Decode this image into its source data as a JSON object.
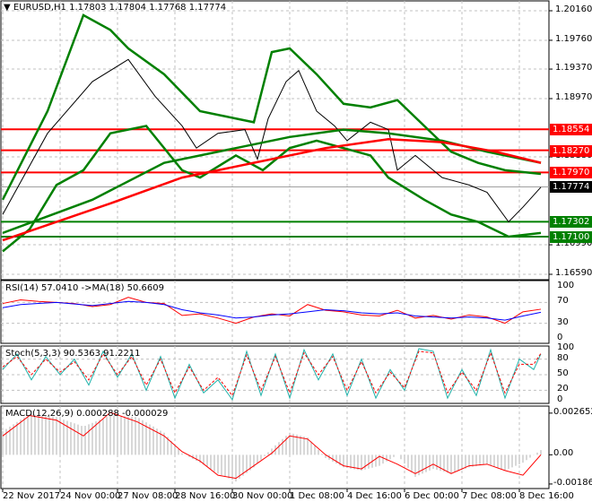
{
  "chart_data": {
    "type": "line",
    "title": "EURUSD,H1",
    "ohlc_header": [
      "1.17803",
      "1.17804",
      "1.17768",
      "1.17774"
    ],
    "price_axis": {
      "ylim": [
        1.1659,
        1.2016
      ],
      "ticks": [
        "1.20160",
        "1.19760",
        "1.19370",
        "1.18970",
        "1.18180",
        "1.16990",
        "1.16590"
      ]
    },
    "time_labels": [
      "22 Nov 2017",
      "24 Nov 00:00",
      "27 Nov 08:00",
      "28 Nov 16:00",
      "30 Nov 00:00",
      "1 Dec 08:00",
      "4 Dec 16:00",
      "6 Dec 00:00",
      "7 Dec 08:00",
      "8 Dec 16:00"
    ],
    "levels": [
      {
        "label": "1.18554",
        "value": 1.18554,
        "color": "#ff0000"
      },
      {
        "label": "1.18270",
        "value": 1.1827,
        "color": "#ff0000"
      },
      {
        "label": "1.17970",
        "value": 1.1797,
        "color": "#ff0000"
      },
      {
        "label": "1.17774",
        "value": 1.17774,
        "color": "#000000",
        "current": true
      },
      {
        "label": "1.17302",
        "value": 1.17302,
        "color": "#008000"
      },
      {
        "label": "1.17100",
        "value": 1.171,
        "color": "#008000"
      }
    ],
    "series": [
      {
        "name": "close",
        "color": "#000000",
        "x": [
          0,
          25,
          50,
          70,
          85,
          100,
          108,
          120,
          135,
          142,
          148,
          158,
          165,
          175,
          185,
          192,
          205,
          215,
          220,
          230,
          245,
          260,
          270,
          282,
          290,
          300
        ],
        "values": [
          1.174,
          1.185,
          1.192,
          1.195,
          1.19,
          1.186,
          1.183,
          1.185,
          1.1855,
          1.1815,
          1.187,
          1.192,
          1.1935,
          1.188,
          1.186,
          1.184,
          1.1865,
          1.1855,
          1.18,
          1.182,
          1.179,
          1.178,
          1.177,
          1.173,
          1.175,
          1.1777
        ]
      },
      {
        "name": "bb_upper",
        "color": "#008000",
        "x": [
          0,
          25,
          45,
          60,
          70,
          90,
          110,
          130,
          140,
          150,
          160,
          175,
          190,
          205,
          220,
          235,
          250,
          265,
          280,
          300
        ],
        "values": [
          1.176,
          1.188,
          1.201,
          1.199,
          1.1965,
          1.193,
          1.188,
          1.187,
          1.1865,
          1.196,
          1.1965,
          1.193,
          1.189,
          1.1885,
          1.1895,
          1.186,
          1.1825,
          1.181,
          1.18,
          1.1795
        ]
      },
      {
        "name": "bb_lower",
        "color": "#008000",
        "x": [
          0,
          15,
          30,
          45,
          60,
          80,
          100,
          110,
          130,
          145,
          160,
          175,
          190,
          205,
          215,
          235,
          250,
          265,
          282,
          300
        ],
        "values": [
          1.169,
          1.172,
          1.178,
          1.18,
          1.185,
          1.186,
          1.18,
          1.179,
          1.182,
          1.18,
          1.183,
          1.184,
          1.183,
          1.182,
          1.179,
          1.176,
          1.174,
          1.173,
          1.171,
          1.1715
        ]
      },
      {
        "name": "ma_green",
        "color": "#008000",
        "x": [
          0,
          50,
          90,
          130,
          160,
          190,
          215,
          245,
          270,
          300
        ],
        "values": [
          1.1715,
          1.176,
          1.181,
          1.183,
          1.1845,
          1.1855,
          1.185,
          1.184,
          1.1825,
          1.181
        ]
      },
      {
        "name": "ma_red",
        "color": "#ff0000",
        "x": [
          0,
          60,
          100,
          140,
          180,
          215,
          245,
          275,
          300
        ],
        "values": [
          1.1705,
          1.1755,
          1.179,
          1.181,
          1.183,
          1.1842,
          1.1838,
          1.1825,
          1.181
        ]
      }
    ],
    "rsi": {
      "label": "RSI(14) 57.0410  ->MA(18) 50.6609",
      "ticks": [
        "100",
        "70",
        "30",
        "0"
      ],
      "ylim": [
        0,
        100
      ],
      "x": [
        0,
        10,
        20,
        30,
        40,
        50,
        60,
        70,
        80,
        90,
        100,
        110,
        120,
        130,
        140,
        150,
        160,
        170,
        180,
        190,
        200,
        210,
        220,
        230,
        240,
        250,
        260,
        270,
        280,
        290,
        300
      ],
      "rsi": [
        68,
        75,
        72,
        70,
        68,
        62,
        66,
        80,
        70,
        68,
        45,
        48,
        40,
        30,
        42,
        48,
        44,
        66,
        55,
        52,
        46,
        44,
        55,
        40,
        45,
        38,
        46,
        42,
        30,
        52,
        57
      ],
      "ma": [
        60,
        66,
        68,
        70,
        67,
        64,
        68,
        72,
        70,
        66,
        56,
        50,
        46,
        40,
        42,
        46,
        48,
        52,
        56,
        54,
        50,
        48,
        50,
        44,
        42,
        40,
        42,
        40,
        36,
        44,
        51
      ]
    },
    "stoch": {
      "label": "Stoch(5,3,3) 90.5363 91.2211",
      "ticks": [
        "100",
        "80",
        "50",
        "20",
        "0"
      ],
      "ylim": [
        0,
        100
      ],
      "x": [
        0,
        8,
        16,
        24,
        32,
        40,
        48,
        56,
        64,
        72,
        80,
        88,
        96,
        104,
        112,
        120,
        128,
        136,
        144,
        152,
        160,
        168,
        176,
        184,
        192,
        200,
        208,
        216,
        224,
        232,
        240,
        248,
        256,
        264,
        272,
        280,
        288,
        296,
        300
      ],
      "main": [
        60,
        90,
        40,
        85,
        50,
        80,
        30,
        95,
        45,
        90,
        20,
        85,
        5,
        70,
        15,
        40,
        2,
        95,
        10,
        90,
        5,
        98,
        40,
        90,
        10,
        80,
        5,
        60,
        20,
        100,
        95,
        5,
        60,
        10,
        98,
        5,
        80,
        60,
        90
      ],
      "signal": [
        65,
        85,
        50,
        80,
        55,
        75,
        40,
        90,
        50,
        85,
        30,
        80,
        15,
        65,
        20,
        45,
        10,
        88,
        20,
        85,
        15,
        92,
        50,
        85,
        20,
        75,
        15,
        55,
        25,
        95,
        92,
        15,
        55,
        20,
        92,
        15,
        70,
        70,
        91
      ]
    },
    "macd": {
      "label": "MACD(12,26,9) 0.000288 -0.000029",
      "ticks": [
        "0.002652",
        "0.00",
        "-0.00186"
      ],
      "ylim": [
        -0.00215,
        0.0031
      ],
      "x": [
        0,
        15,
        30,
        45,
        60,
        75,
        90,
        100,
        110,
        120,
        130,
        140,
        150,
        160,
        170,
        180,
        190,
        200,
        210,
        220,
        230,
        240,
        250,
        260,
        270,
        280,
        290,
        300
      ],
      "hist": [
        0.0015,
        0.0026,
        0.0024,
        0.0018,
        0.0025,
        0.0024,
        0.0014,
        0.0001,
        -0.0005,
        -0.0012,
        -0.0017,
        -0.0008,
        0.0004,
        0.0014,
        0.0011,
        -0.0002,
        -0.0008,
        -0.001,
        -0.0007,
        0.0,
        -0.0014,
        -0.0009,
        -0.0012,
        -0.0008,
        -0.0006,
        -0.001,
        -0.0005,
        0.0003
      ],
      "signal": [
        0.0012,
        0.0025,
        0.0022,
        0.0012,
        0.0027,
        0.0021,
        0.0012,
        0.0002,
        -0.0004,
        -0.0013,
        -0.0015,
        -0.0007,
        0.0001,
        0.0012,
        0.001,
        0.0,
        -0.0007,
        -0.0009,
        -0.0001,
        -0.0006,
        -0.0012,
        -0.0006,
        -0.0012,
        -0.0007,
        -0.0006,
        -0.001,
        -0.0013,
        0.0
      ]
    }
  }
}
